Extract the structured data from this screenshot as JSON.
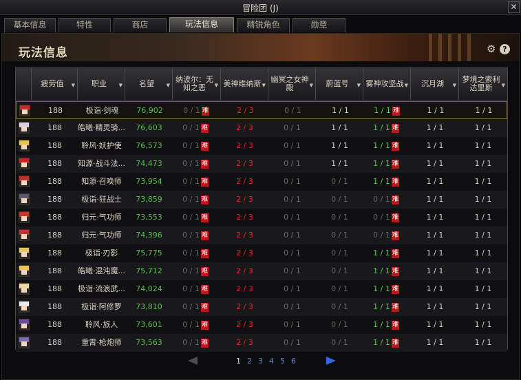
{
  "window": {
    "title": "冒险团 (J)",
    "close_label": "✕"
  },
  "tabs": [
    {
      "label": "基本信息",
      "active": false
    },
    {
      "label": "特性",
      "active": false
    },
    {
      "label": "商店",
      "active": false
    },
    {
      "label": "玩法信息",
      "active": true
    },
    {
      "label": "精锐角色",
      "active": false
    },
    {
      "label": "勋章",
      "active": false
    }
  ],
  "banner": {
    "title": "玩法信息",
    "gear_icon": "gear-icon",
    "help_label": "?"
  },
  "columns": [
    {
      "label": "疲劳值",
      "sortable": true
    },
    {
      "label": "职业",
      "sortable": true
    },
    {
      "label": "名望",
      "sortable": true
    },
    {
      "label": "纳波尔：无知之恶",
      "sortable": true
    },
    {
      "label": "美神维纳斯",
      "sortable": true
    },
    {
      "label": "幽冥之女神殿",
      "sortable": true
    },
    {
      "label": "蔚蓝号",
      "sortable": true
    },
    {
      "label": "雾神攻坚战",
      "sortable": true
    },
    {
      "label": "沉月湖",
      "sortable": true
    },
    {
      "label": "梦境之索利达里斯",
      "sortable": true
    }
  ],
  "tag_label": "难",
  "rows": [
    {
      "fatigue": "188",
      "job": "极诣·剑魂",
      "fame": "76,902",
      "c1": "0 / 1",
      "c2": "2 / 3",
      "c3": "0 / 1",
      "c4": "1 / 1",
      "c5": "1 / 1",
      "c5_tag": true,
      "c6": "1 / 1",
      "c7": "1 / 1",
      "hair": "#c22828"
    },
    {
      "fatigue": "188",
      "job": "皓曦·精灵骑...",
      "fame": "76,603",
      "c1": "0 / 1",
      "c2": "2 / 3",
      "c3": "0 / 1",
      "c4": "1 / 1",
      "c5": "1 / 1",
      "c5_tag": true,
      "c6": "1 / 1",
      "c7": "1 / 1",
      "hair": "#d6d0e8"
    },
    {
      "fatigue": "188",
      "job": "聆风·妖护使",
      "fame": "76,573",
      "c1": "0 / 1",
      "c2": "2 / 3",
      "c3": "0 / 1",
      "c4": "1 / 1",
      "c5": "1 / 1",
      "c5_tag": true,
      "c6": "1 / 1",
      "c7": "1 / 1",
      "hair": "#e8c24a"
    },
    {
      "fatigue": "188",
      "job": "知源·战斗法...",
      "fame": "74,473",
      "c1": "0 / 1",
      "c2": "2 / 3",
      "c3": "0 / 1",
      "c4": "1 / 1",
      "c5": "1 / 1",
      "c5_tag": true,
      "c6": "1 / 1",
      "c7": "1 / 1",
      "hair": "#c42626"
    },
    {
      "fatigue": "188",
      "job": "知源·召唤师",
      "fame": "73,954",
      "c1": "0 / 1",
      "c2": "2 / 3",
      "c3": "0 / 1",
      "c4": "0 / 1",
      "c5": "1 / 1",
      "c5_tag": true,
      "c6": "1 / 1",
      "c7": "1 / 1",
      "hair": "#b83226"
    },
    {
      "fatigue": "188",
      "job": "极诣·狂战士",
      "fame": "73,859",
      "c1": "0 / 1",
      "c2": "2 / 3",
      "c3": "0 / 1",
      "c4": "0 / 1",
      "c5": "0 / 1",
      "c5_tag": true,
      "c6": "1 / 1",
      "c7": "1 / 1",
      "hair": "#5a5a6e"
    },
    {
      "fatigue": "188",
      "job": "归元·气功师",
      "fame": "73,553",
      "c1": "0 / 1",
      "c2": "2 / 3",
      "c3": "0 / 1",
      "c4": "0 / 1",
      "c5": "0 / 1",
      "c5_tag": true,
      "c6": "1 / 1",
      "c7": "1 / 1",
      "hair": "#c23a2a"
    },
    {
      "fatigue": "188",
      "job": "归元·气功师",
      "fame": "74,396",
      "c1": "0 / 1",
      "c2": "2 / 3",
      "c3": "0 / 1",
      "c4": "0 / 1",
      "c5": "0 / 1",
      "c5_tag": true,
      "c6": "1 / 1",
      "c7": "1 / 1",
      "hair": "#c8302c"
    },
    {
      "fatigue": "188",
      "job": "极诣·刃影",
      "fame": "75,775",
      "c1": "0 / 1",
      "c2": "2 / 3",
      "c3": "0 / 1",
      "c4": "0 / 1",
      "c5": "1 / 1",
      "c5_tag": true,
      "c6": "1 / 1",
      "c7": "1 / 1",
      "hair": "#e6c866"
    },
    {
      "fatigue": "188",
      "job": "皓曦·混沌魔...",
      "fame": "75,712",
      "c1": "0 / 1",
      "c2": "2 / 3",
      "c3": "0 / 1",
      "c4": "0 / 1",
      "c5": "1 / 1",
      "c5_tag": true,
      "c6": "1 / 1",
      "c7": "1 / 1",
      "hair": "#eac850"
    },
    {
      "fatigue": "188",
      "job": "极诣·流浪武...",
      "fame": "74,024",
      "c1": "0 / 1",
      "c2": "2 / 3",
      "c3": "0 / 1",
      "c4": "0 / 1",
      "c5": "1 / 1",
      "c5_tag": true,
      "c6": "1 / 1",
      "c7": "1 / 1",
      "hair": "#ecd8a0"
    },
    {
      "fatigue": "188",
      "job": "极诣·阿修罗",
      "fame": "73,810",
      "c1": "0 / 1",
      "c2": "2 / 3",
      "c3": "0 / 1",
      "c4": "0 / 1",
      "c5": "1 / 1",
      "c5_tag": true,
      "c6": "1 / 1",
      "c7": "1 / 1",
      "hair": "#e8e8ee"
    },
    {
      "fatigue": "188",
      "job": "聆风·旅人",
      "fame": "73,601",
      "c1": "0 / 1",
      "c2": "2 / 3",
      "c3": "0 / 1",
      "c4": "0 / 1",
      "c5": "1 / 1",
      "c5_tag": true,
      "c6": "1 / 1",
      "c7": "1 / 1",
      "hair": "#6a4a9a"
    },
    {
      "fatigue": "188",
      "job": "重霄·枪炮师",
      "fame": "73,563",
      "c1": "0 / 1",
      "c2": "2 / 3",
      "c3": "0 / 1",
      "c4": "0 / 1",
      "c5": "1 / 1",
      "c5_tag": true,
      "c6": "1 / 1",
      "c7": "1 / 1",
      "hair": "#7a6ab8"
    }
  ],
  "pagination": {
    "pages": [
      "1",
      "2",
      "3",
      "4",
      "5",
      "6"
    ],
    "current": "1"
  }
}
